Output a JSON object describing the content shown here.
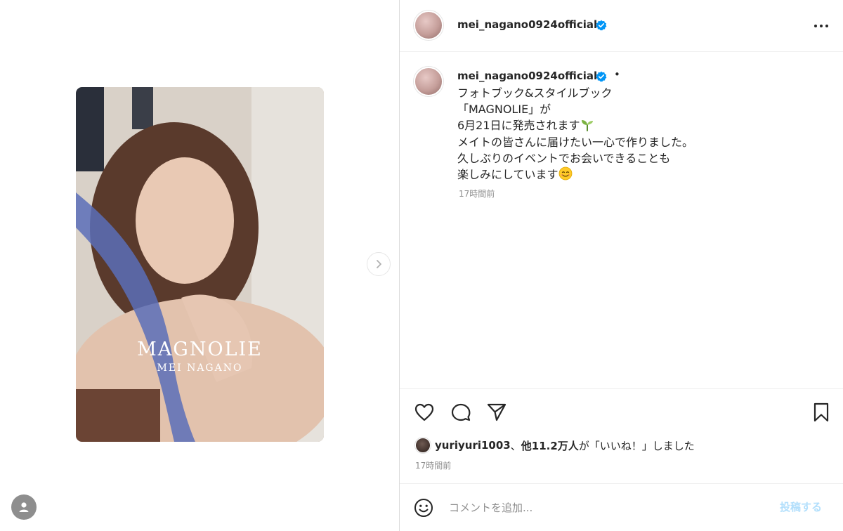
{
  "colors": {
    "text": "#262626",
    "secondary": "#8e8e8e",
    "verified": "#0095f6",
    "post_disabled": "#b2dffc",
    "divider": "#dbdbdb"
  },
  "media": {
    "cover_title": "MAGNOLIE",
    "cover_subtitle": "MEI NAGANO",
    "next_icon": "chevron-right-icon",
    "profile_icon": "user-icon"
  },
  "header": {
    "username": "mei_nagano0924official",
    "verified_icon": "verified-badge-icon",
    "more_icon": "more-horizontal-icon"
  },
  "caption": {
    "username": "mei_nagano0924official",
    "separator": "•",
    "lines": [
      "フォトブック&スタイルブック",
      "「MAGNOLIE」が",
      "6月21日に発売されます",
      "メイトの皆さんに届けたい一心で作りました。",
      "久しぶりのイベントでお会いできることも",
      "楽しみにしています"
    ],
    "time": "17時間前"
  },
  "actions": {
    "like_icon": "heart-icon",
    "comment_icon": "comment-icon",
    "share_icon": "paper-plane-icon",
    "save_icon": "bookmark-icon"
  },
  "likes": {
    "user": "yuriyuri1003",
    "sep": "、",
    "others": "他11.2万人",
    "suffix": "が「いいね！」しました"
  },
  "post_time": "17時間前",
  "comment": {
    "placeholder": "コメントを追加...",
    "post_label": "投稿する",
    "emoji_icon": "smiley-icon"
  }
}
